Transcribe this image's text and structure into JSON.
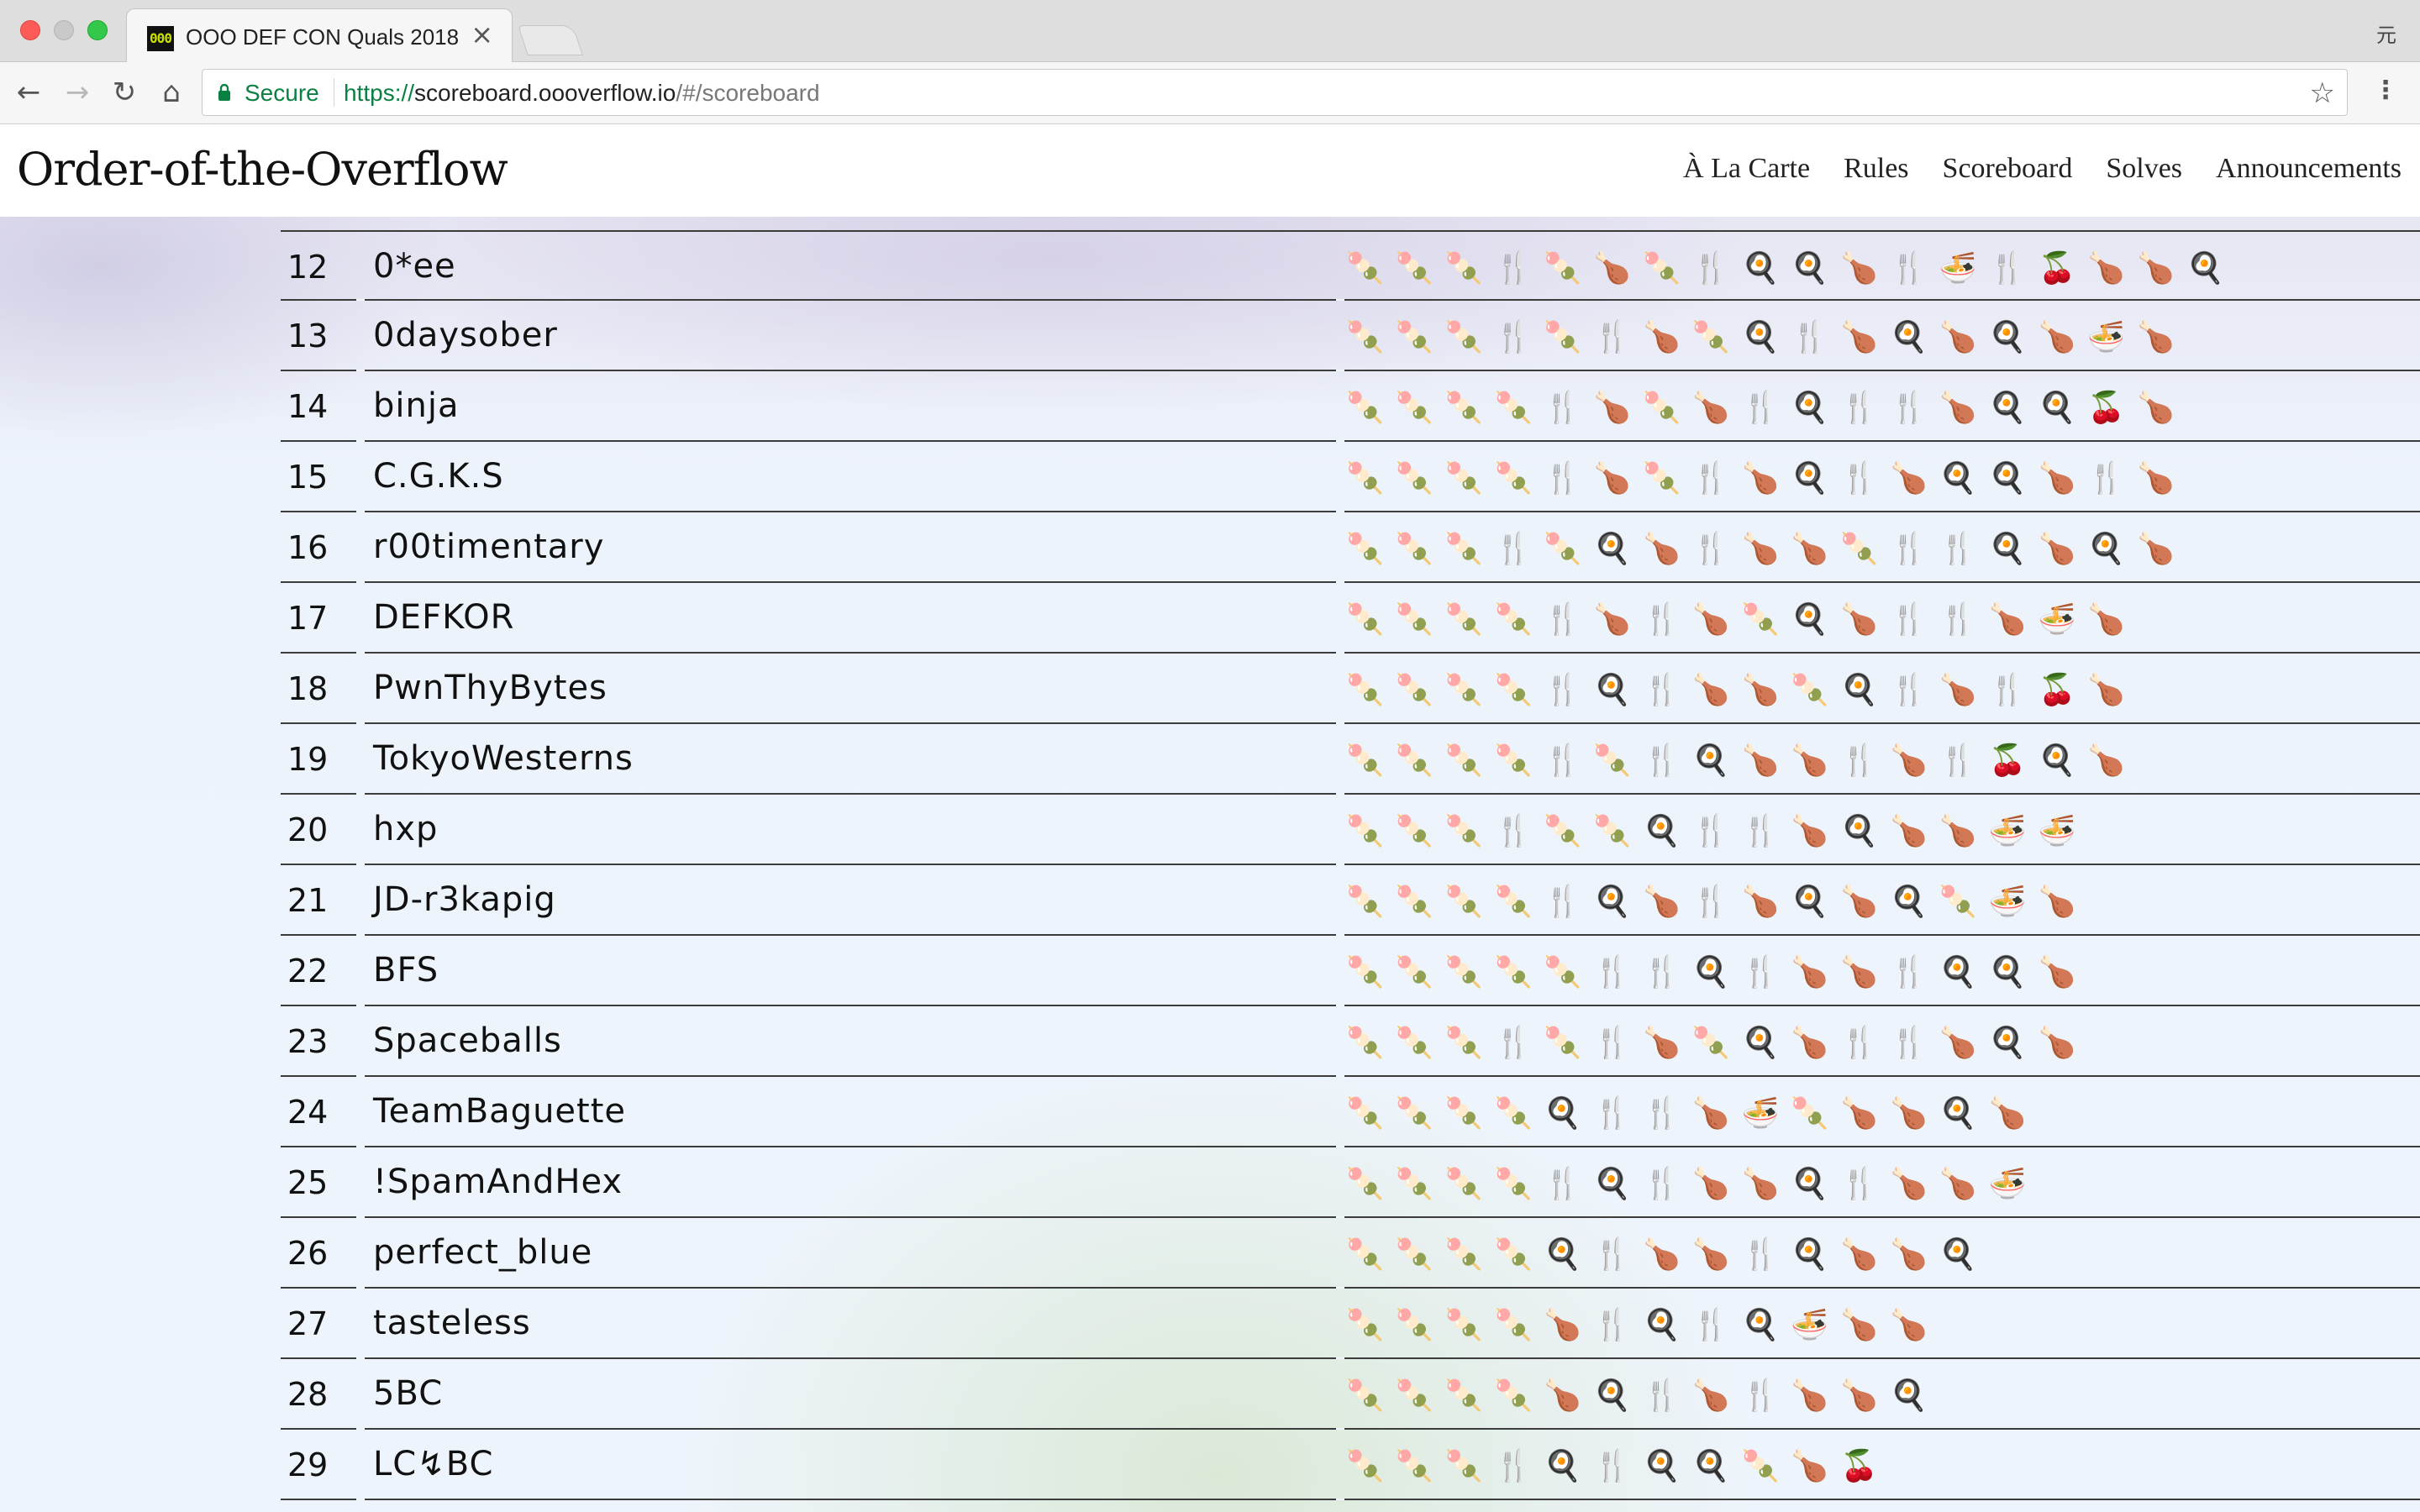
{
  "browser": {
    "tab_title": "OOO DEF CON Quals 2018",
    "tab_favicon": "000",
    "close_glyph": "×",
    "profile_glyph": "元",
    "secure_label": "Secure",
    "url_scheme": "https://",
    "url_host": "scoreboard.oooverflow.io",
    "url_path": "/#/scoreboard"
  },
  "site": {
    "brand": "Order-of-the-Overflow",
    "nav": [
      "À La Carte",
      "Rules",
      "Scoreboard",
      "Solves",
      "Announcements"
    ]
  },
  "scoreboard": [
    {
      "rank": "12",
      "team": "0*ee",
      "solves": "🍡🍡🍡🍴🍡🍗🍡🍴🍳🍳🍗🍴🍜🍴🍒🍗🍗🍳"
    },
    {
      "rank": "13",
      "team": "0daysober",
      "solves": "🍡🍡🍡🍴🍡🍴🍗🍡🍳🍴🍗🍳🍗🍳🍗🍜🍗"
    },
    {
      "rank": "14",
      "team": "binja",
      "solves": "🍡🍡🍡🍡🍴🍗🍡🍗🍴🍳🍴🍴🍗🍳🍳🍒🍗"
    },
    {
      "rank": "15",
      "team": "C.G.K.S",
      "solves": "🍡🍡🍡🍡🍴🍗🍡🍴🍗🍳🍴🍗🍳🍳🍗🍴🍗"
    },
    {
      "rank": "16",
      "team": "r00timentary",
      "solves": "🍡🍡🍡🍴🍡🍳🍗🍴🍗🍗🍡🍴🍴🍳🍗🍳🍗"
    },
    {
      "rank": "17",
      "team": "DEFKOR",
      "solves": "🍡🍡🍡🍡🍴🍗🍴🍗🍡🍳🍗🍴🍴🍗🍜🍗"
    },
    {
      "rank": "18",
      "team": "PwnThyBytes",
      "solves": "🍡🍡🍡🍡🍴🍳🍴🍗🍗🍡🍳🍴🍗🍴🍒🍗"
    },
    {
      "rank": "19",
      "team": "TokyoWesterns",
      "solves": "🍡🍡🍡🍡🍴🍡🍴🍳🍗🍗🍴🍗🍴🍒🍳🍗"
    },
    {
      "rank": "20",
      "team": "hxp",
      "solves": "🍡🍡🍡🍴🍡🍡🍳🍴🍴🍗🍳🍗🍗🍜🍜"
    },
    {
      "rank": "21",
      "team": "JD-r3kapig",
      "solves": "🍡🍡🍡🍡🍴🍳🍗🍴🍗🍳🍗🍳🍡🍜🍗"
    },
    {
      "rank": "22",
      "team": "BFS",
      "solves": "🍡🍡🍡🍡🍡🍴🍴🍳🍴🍗🍗🍴🍳🍳🍗"
    },
    {
      "rank": "23",
      "team": "Spaceballs",
      "solves": "🍡🍡🍡🍴🍡🍴🍗🍡🍳🍗🍴🍴🍗🍳🍗"
    },
    {
      "rank": "24",
      "team": "TeamBaguette",
      "solves": "🍡🍡🍡🍡🍳🍴🍴🍗🍜🍡🍗🍗🍳🍗"
    },
    {
      "rank": "25",
      "team": "!SpamAndHex",
      "solves": "🍡🍡🍡🍡🍴🍳🍴🍗🍗🍳🍴🍗🍗🍜"
    },
    {
      "rank": "26",
      "team": "perfect_blue",
      "solves": "🍡🍡🍡🍡🍳🍴🍗🍗🍴🍳🍗🍗🍳"
    },
    {
      "rank": "27",
      "team": "tasteless",
      "solves": "🍡🍡🍡🍡🍗🍴🍳🍴🍳🍜🍗🍗"
    },
    {
      "rank": "28",
      "team": "5BC",
      "solves": "🍡🍡🍡🍡🍗🍳🍴🍗🍴🍗🍗🍳"
    },
    {
      "rank": "29",
      "team": "LC↯BC",
      "solves": "🍡🍡🍡🍴🍳🍴🍳🍳🍡🍗🍒"
    }
  ]
}
